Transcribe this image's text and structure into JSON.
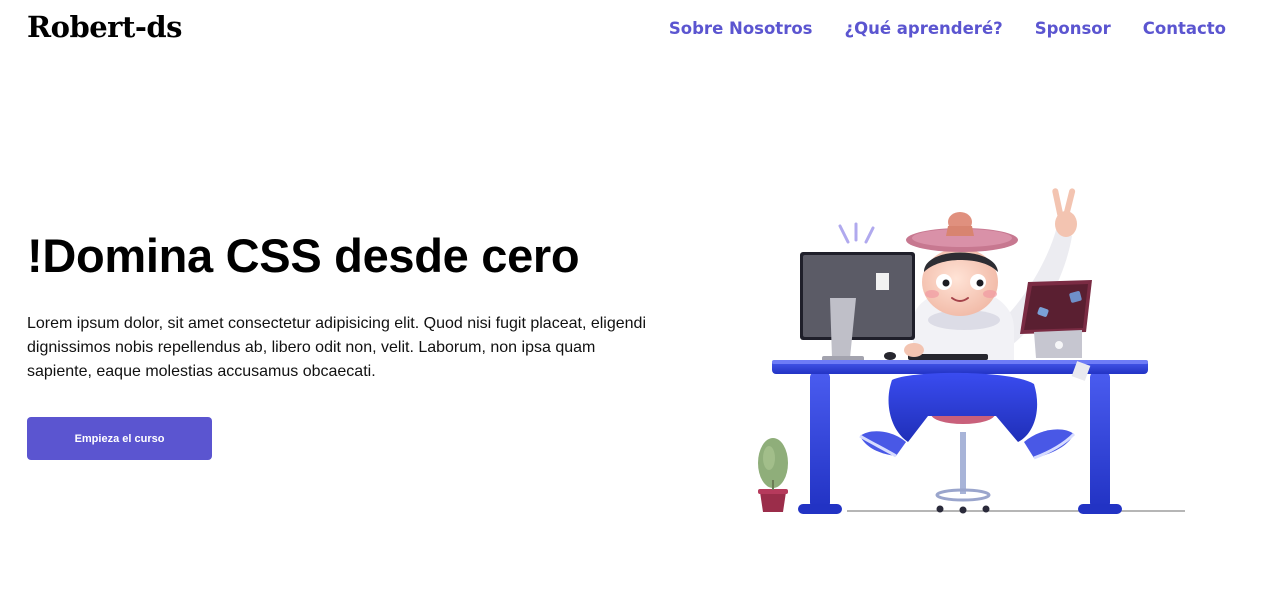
{
  "header": {
    "logo": "Robert-ds",
    "nav": [
      {
        "label": "Sobre Nosotros"
      },
      {
        "label": "¿Qué aprenderé?"
      },
      {
        "label": "Sponsor"
      },
      {
        "label": "Contacto"
      }
    ]
  },
  "hero": {
    "title": "!Domina CSS desde cero",
    "text": "Lorem ipsum dolor, sit amet consectetur adipisicing elit. Quod nisi fugit placeat, eligendi dignissimos nobis repellendus ab, libero odit non, velit. Laborum, non ipsa quam sapiente, eaque molestias accusamus obcaecati.",
    "cta_label": "Empieza el curso"
  },
  "colors": {
    "accent": "#5b55d0",
    "desk": "#2e3fd6",
    "text": "#000000"
  }
}
